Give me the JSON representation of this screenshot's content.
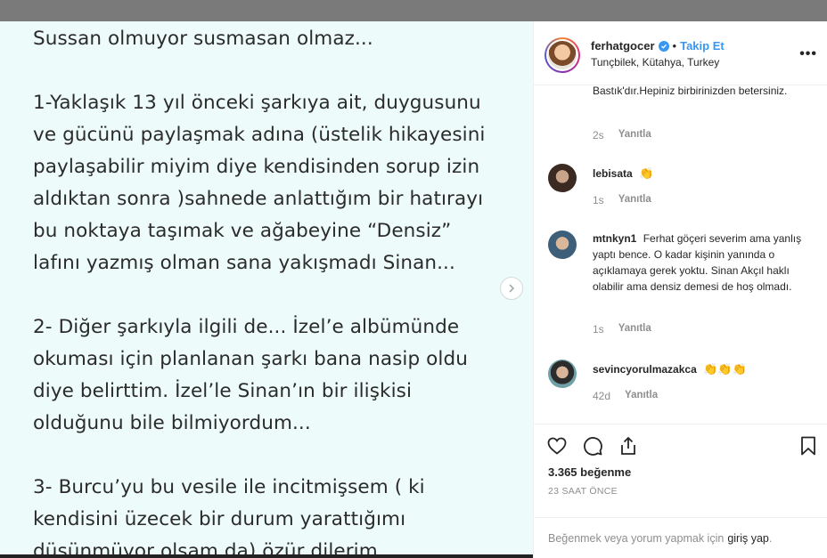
{
  "post": {
    "text_lines": "Sussan olmuyor susmasan olmaz...\n\n1-Yaklaşık 13 yıl önceki şarkıya ait, duygusunu\nve gücünü paylaşmak adına (üstelik hikayesini\npaylaşabilir miyim diye kendisinden sorup izin\naldıktan sonra )sahnede anlattığım  bir hatırayı\nbu noktaya taşımak ve ağabeyine “Densiz”\nlafını yazmış olman sana yakışmadı Sinan...\n\n2- Diğer şarkıyla ilgili de...   İzel’e albümünde\nokuması için planlanan şarkı bana nasip oldu\ndiye belirttim.   İzel’le Sinan’ın bir ilişkisi\nolduğunu bile bilmiyordum...\n\n3- Burcu’yu bu vesile ile incitmişsem ( ki\nkendisini üzecek bir durum yarattığımı\ndüşünmüyor olsam da) özür dilerim..."
  },
  "header": {
    "username": "ferhatgocer",
    "separator": "•",
    "follow_label": "Takip Et",
    "location": "Tunçbilek, Kütahya, Turkey",
    "more_label": "•••"
  },
  "comments": [
    {
      "text": "Bastık'dır.Hepiniz birbirinizden betersiniz.",
      "time": "2s",
      "reply_label": "Yanıtla"
    },
    {
      "username": "lebisata",
      "text": "👏",
      "time": "1s",
      "reply_label": "Yanıtla"
    },
    {
      "username": "mtnkyn1",
      "text": "Ferhat göçeri severim ama yanlış yaptı bence. O kadar kişinin yanında o açıklamaya gerek yoktu. Sinan Akçıl haklı olabilir ama densiz demesi de hoş olmadı.",
      "time": "1s",
      "reply_label": "Yanıtla"
    },
    {
      "username": "sevincyorulmazakca",
      "text": "👏👏👏",
      "time": "42d",
      "reply_label": "Yanıtla"
    }
  ],
  "actions": {
    "likes": "3.365 beğenme",
    "time_ago": "23 SAAT ÖNCE",
    "login_prompt": "Beğenmek veya yorum yapmak için",
    "login_link": "giriş yap",
    "login_suffix": "."
  },
  "colors": {
    "accent": "#3897f0",
    "muted": "#8e8e8e",
    "post_bg": "#eefbfb",
    "text": "#262626"
  },
  "icons": [
    "heart-icon",
    "comment-icon",
    "share-icon",
    "bookmark-icon",
    "chevron-right-icon",
    "verified-icon"
  ]
}
